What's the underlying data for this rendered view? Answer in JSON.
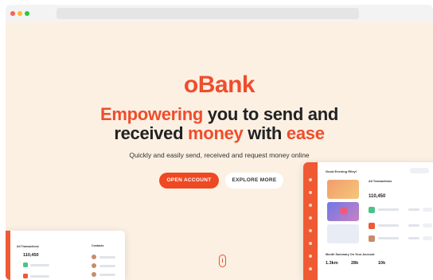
{
  "brand": {
    "logo_text": "oBank",
    "accent_color": "#ef4d2c"
  },
  "hero": {
    "headline_line1_accent": "Empowering",
    "headline_line1_rest": " you to send and",
    "headline_line2_start": "received ",
    "headline_line2_accent1": "money",
    "headline_line2_mid": " with ",
    "headline_line2_accent2": "ease",
    "subtitle": "Quickly and easily send, received and request money online"
  },
  "actions": {
    "primary_label": "OPEN ACCOUNT",
    "secondary_label": "EXPLORE MORE"
  },
  "dashboard_right": {
    "greeting": "Good Evening Riley!",
    "section_title": "All Transactions",
    "balance": "110,450",
    "summary_title": "Month Summary On Your Account",
    "stats": [
      "1.3km",
      "28k",
      "10k"
    ]
  },
  "dashboard_left": {
    "section_title": "All Transactions",
    "balance": "110,450",
    "contacts_title": "Contacts"
  }
}
